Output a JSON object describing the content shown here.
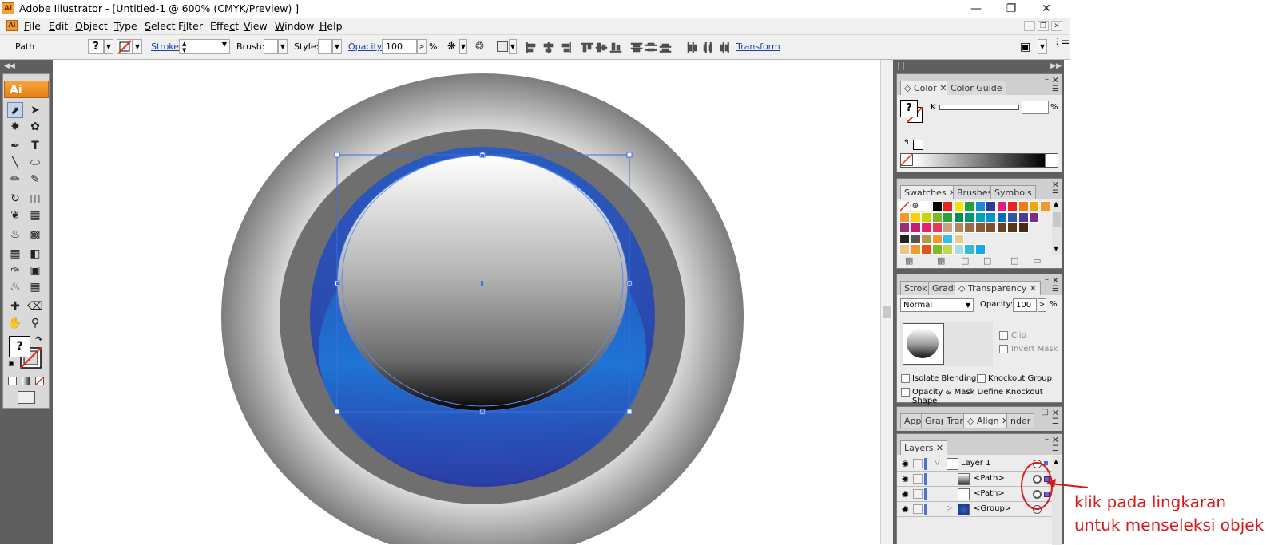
{
  "window": {
    "title": "Adobe Illustrator - [Untitled-1 @ 600% (CMYK/Preview) ]",
    "app_icon": "Ai"
  },
  "menu": [
    "File",
    "Edit",
    "Object",
    "Type",
    "Select",
    "Filter",
    "Effect",
    "View",
    "Window",
    "Help"
  ],
  "menu_mnemonics": [
    "F",
    "E",
    "O",
    "T",
    "S",
    "i",
    "c",
    "V",
    "W",
    "H"
  ],
  "control": {
    "selection_type": "Path",
    "fill_label": "?",
    "stroke_label": "Stroke:",
    "brush_label": "Brush:",
    "style_label": "Style:",
    "opacity_label": "Opacity:",
    "opacity_value": "100",
    "opacity_unit": "%",
    "arrow": ">",
    "transform_label": "Transform"
  },
  "tools": {
    "logo": "Ai",
    "fill_box": "?"
  },
  "color_panel": {
    "tabs": [
      "Color",
      "Color Guide"
    ],
    "channel": "K",
    "unit": "%",
    "fill_label": "?"
  },
  "swatches_panel": {
    "tabs": [
      "Swatches",
      "Brushes",
      "Symbols"
    ],
    "rows": [
      [
        "none",
        "reg",
        "#ffffff",
        "#000000",
        "#e52620",
        "#f2e300",
        "#1fa23a",
        "#1b8bd0",
        "#2c3b95",
        "#e5197f",
        "#e52620",
        "#ee7d18",
        "#f7a600",
        "#f39a2e"
      ],
      [
        "#f39a2e",
        "#fdd000",
        "#c8d300",
        "#7ab929",
        "#2e9f3d",
        "#008a4e",
        "#00957b",
        "#00a3b3",
        "#0093d3",
        "#0070b8",
        "#2a5aa7",
        "#4b3c93",
        "#7a2d8a"
      ],
      [
        "#9a2c7d",
        "#c61d74",
        "#e6216e",
        "#e7385d",
        "#c7a385",
        "#b08564",
        "#9c6b43",
        "#8b5a35",
        "#7d4f2b",
        "#6c4223",
        "#5b3518",
        "#4a2a12"
      ],
      [
        "#222222",
        "#555555",
        "#b79a47",
        "#f39a2e",
        "#34bfee",
        "#f0c887"
      ],
      [
        "#f2c28c",
        "#f39a2e",
        "#e6521f",
        "#7ab929",
        "#bfd84d",
        "#a9dbe4",
        "#36b8da",
        "#15a9de"
      ]
    ]
  },
  "transparency_panel": {
    "tabs": [
      "Strok",
      "Gradi",
      "Transparency"
    ],
    "blend_mode": "Normal",
    "opacity_label": "Opacity:",
    "opacity_value": "100",
    "unit": "%",
    "arrow": ">",
    "clip": "Clip",
    "invert_mask": "Invert Mask",
    "isolate_blending": "Isolate Blending",
    "knockout_group": "Knockout Group",
    "opacity_mask": "Opacity & Mask Define Knockout Shape"
  },
  "align_panel": {
    "tabs": [
      "App",
      "Grap",
      "Tran",
      "Align",
      "nder"
    ]
  },
  "layers_panel": {
    "tabs": [
      "Layers"
    ],
    "rows": [
      {
        "name": "Layer 1"
      },
      {
        "name": "<Path>"
      },
      {
        "name": "<Path>"
      },
      {
        "name": "<Group>"
      }
    ]
  },
  "annotation": {
    "line1": "klik pada lingkaran",
    "line2": "untuk menseleksi objek",
    "color": "#d81818"
  },
  "colors": {
    "accent": "#f39a2e",
    "selection": "#3a6fe0",
    "workspace": "#5f5f5f"
  }
}
